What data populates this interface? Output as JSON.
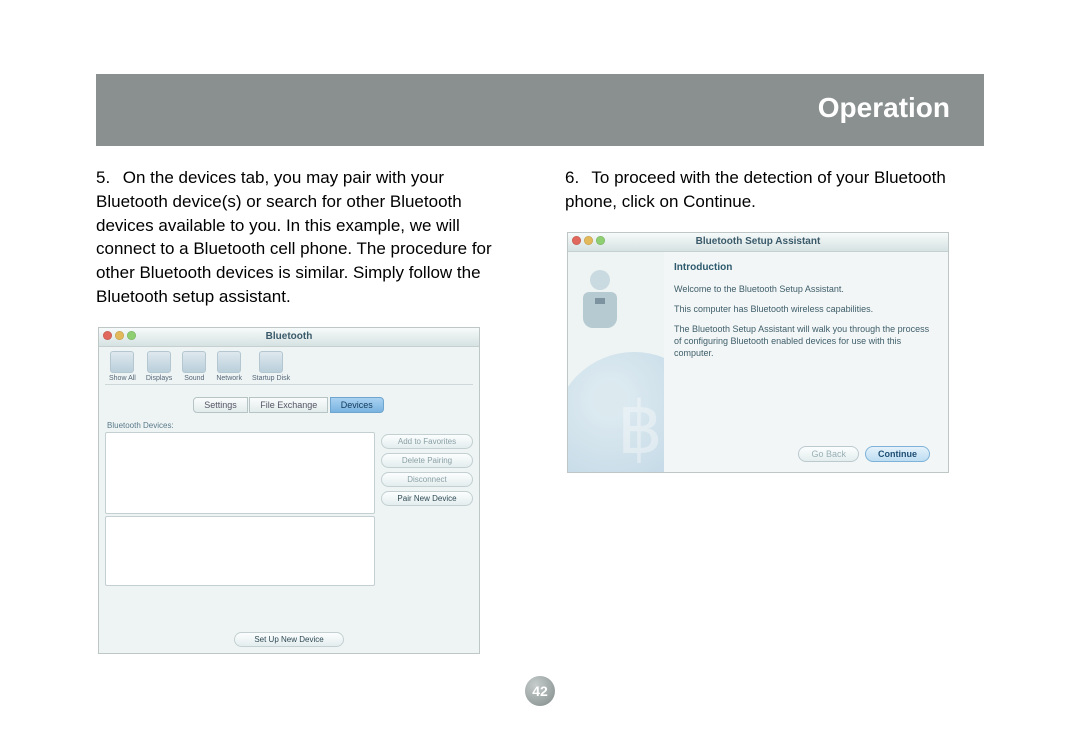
{
  "banner": {
    "title": "Operation"
  },
  "page_number": "42",
  "left": {
    "step_num": "5.",
    "step_text": "On the devices tab, you may pair with your Bluetooth device(s) or search for other Bluetooth devices available to you.  In this example, we will connect to a Bluetooth cell phone.  The procedure for other Bluetooth devices is similar.  Simply follow the Bluetooth setup assistant.",
    "window": {
      "title": "Bluetooth",
      "toolbar": {
        "show_all": "Show All",
        "displays": "Displays",
        "sound": "Sound",
        "network": "Network",
        "startup_disk": "Startup Disk"
      },
      "tabs": {
        "settings": "Settings",
        "file_exchange": "File Exchange",
        "devices": "Devices"
      },
      "devices_label": "Bluetooth Devices:",
      "buttons": {
        "add_fav": "Add to Favorites",
        "delete_pairing": "Delete Pairing",
        "disconnect": "Disconnect",
        "pair_new": "Pair New Device",
        "setup_new": "Set Up New Device"
      }
    }
  },
  "right": {
    "step_num": "6.",
    "step_text": "To proceed with the detection of your Bluetooth phone, click on Continue.",
    "window": {
      "title": "Bluetooth Setup Assistant",
      "heading": "Introduction",
      "p1": "Welcome to the Bluetooth Setup Assistant.",
      "p2": "This computer has Bluetooth wireless capabilities.",
      "p3": "The Bluetooth Setup Assistant will walk you through the process of configuring Bluetooth enabled devices for use with this computer.",
      "buttons": {
        "go_back": "Go Back",
        "continue": "Continue"
      }
    }
  }
}
